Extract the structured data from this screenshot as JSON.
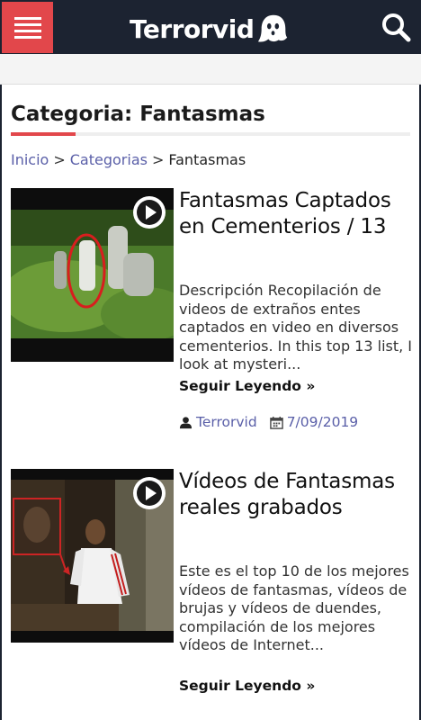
{
  "header": {
    "logo_text": "Terrorvid",
    "menu_icon": "hamburger-menu-icon",
    "search_icon": "search-icon",
    "colors": {
      "bar": "#1c2331",
      "accent": "#e2474b"
    }
  },
  "page": {
    "title": "Categoria: Fantasmas"
  },
  "breadcrumb": {
    "items": [
      "Inicio",
      "Categorias",
      "Fantasmas"
    ],
    "separator": ">"
  },
  "posts": [
    {
      "title": "Fantasmas Captados en Cementerios / 13",
      "excerpt": "Descripción Recopilación de videos de extraños entes captados en video en diversos cementerios. In this top 13 list, I look at mysteri...",
      "read_more": "Seguir Leyendo »",
      "author": "Terrorvid",
      "date": "7/09/2019"
    },
    {
      "title": "Vídeos de Fantasmas reales grabados",
      "excerpt": "Este es el top 10 de los mejores vídeos de fantasmas, vídeos de brujas y vídeos de duendes, compilación de los mejores vídeos de Internet...",
      "read_more": "Seguir Leyendo »"
    }
  ]
}
